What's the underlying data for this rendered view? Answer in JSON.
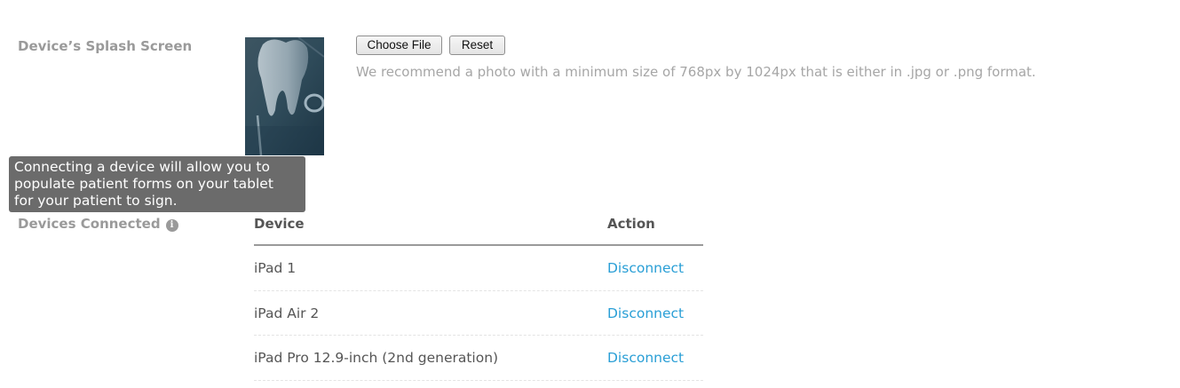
{
  "splash": {
    "label": "Device’s Splash Screen",
    "thumbnail_icon": "tooth-photo-thumbnail",
    "choose_file_label": "Choose File",
    "reset_label": "Reset",
    "recommendation": "We recommend a photo with a minimum size of 768px by 1024px that is either in .jpg or .png format."
  },
  "tooltip": {
    "lines": [
      "Connecting a device will allow you to",
      "populate patient forms on your tablet",
      "for your patient to sign."
    ]
  },
  "devices": {
    "label": "Devices Connected",
    "info_icon": "info-icon",
    "columns": [
      "Device",
      "Action"
    ],
    "rows": [
      {
        "device": "iPad 1",
        "action": "Disconnect"
      },
      {
        "device": "iPad Air 2",
        "action": "Disconnect"
      },
      {
        "device": "iPad Pro 12.9-inch (2nd generation)",
        "action": "Disconnect"
      }
    ]
  },
  "colors": {
    "link": "#2a9fd6",
    "tooltip_bg": "#6b6b6b",
    "label": "#9a9a9a"
  }
}
